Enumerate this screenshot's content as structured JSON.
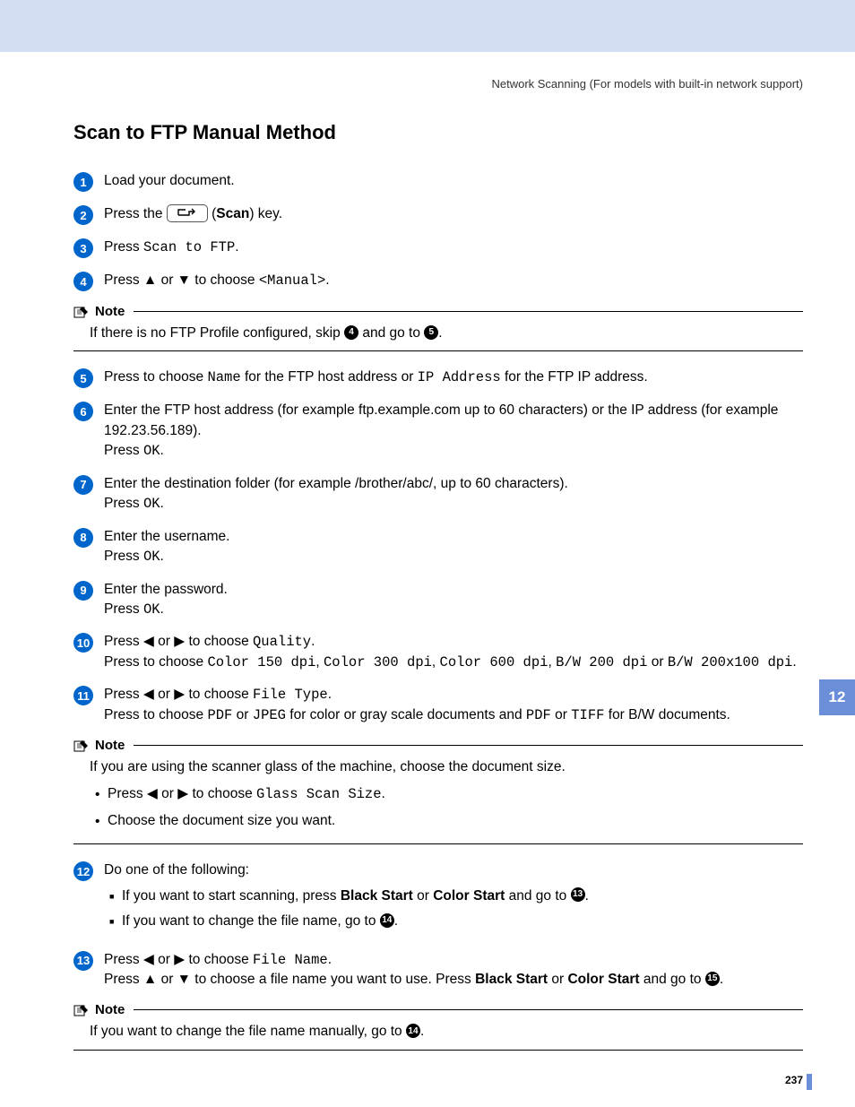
{
  "header": "Network Scanning  (For models with built-in network support)",
  "title": "Scan to FTP Manual Method",
  "scan_word": "Scan",
  "step1": "Load your document.",
  "step2_a": "Press the ",
  "step2_b": " (",
  "step2_c": ") key.",
  "step3_a": "Press ",
  "step3_code": "Scan to FTP",
  "step3_b": ".",
  "step4_a": "Press ▲ or ▼ to choose ",
  "step4_code": "<Manual>",
  "step4_b": ".",
  "note_label": "Note",
  "note1_a": "If there is no FTP Profile configured, skip ",
  "note1_b": " and go to ",
  "note1_c": ".",
  "ref4": "4",
  "ref5": "5",
  "step5_a": "Press to choose ",
  "step5_code1": "Name",
  "step5_b": " for the FTP host address or ",
  "step5_code2": "IP Address",
  "step5_c": " for the FTP IP address.",
  "step6_a": "Enter the FTP host address (for example ftp.example.com up to 60 characters) or the IP address (for example 192.23.56.189).",
  "press_ok": "Press ",
  "ok": "OK",
  "step7": "Enter the destination folder (for example /brother/abc/, up to 60 characters).",
  "step8": "Enter the username.",
  "step9": "Enter the password.",
  "step10_a": "Press ◀ or ▶ to choose ",
  "step10_code": "Quality",
  "step10_b": ".",
  "step10_c": "Press to choose ",
  "q1": "Color 150 dpi",
  "q2": "Color 300 dpi",
  "q3": "Color 600 dpi",
  "q4": "B/W 200 dpi",
  "q5": "B/W 200x100 dpi",
  "or": " or ",
  "comma": ", ",
  "step11_a": "Press ◀ or ▶ to choose ",
  "step11_code": "File Type",
  "step11_b": ".",
  "step11_c": "Press to choose ",
  "pdf": "PDF",
  "jpeg": "JPEG",
  "tiff": "TIFF",
  "step11_d": " for color or gray scale documents and ",
  "step11_e": " for B/W documents.",
  "note2_head": "If you are using the scanner glass of the machine, choose the document size.",
  "note2_li1_a": "Press ◀ or ▶ to choose ",
  "note2_li1_code": "Glass Scan Size",
  "note2_li2": "Choose the document size you want.",
  "step12": "Do one of the following:",
  "step12_li1_a": "If you want to start scanning, press ",
  "black_start": "Black Start",
  "color_start": "Color Start",
  "step12_li1_b": " and go to ",
  "ref13": "13",
  "step12_li2_a": "If you want to change the file name, go to ",
  "ref14": "14",
  "step13_a": "Press ◀ or ▶ to choose ",
  "step13_code": "File Name",
  "step13_b": ".",
  "step13_c": "Press ▲ or ▼ to choose a file name you want to use. Press ",
  "step13_d": " and go to ",
  "ref15": "15",
  "note3": "If you want to change the file name manually, go to ",
  "side_tab": "12",
  "page_num": "237"
}
